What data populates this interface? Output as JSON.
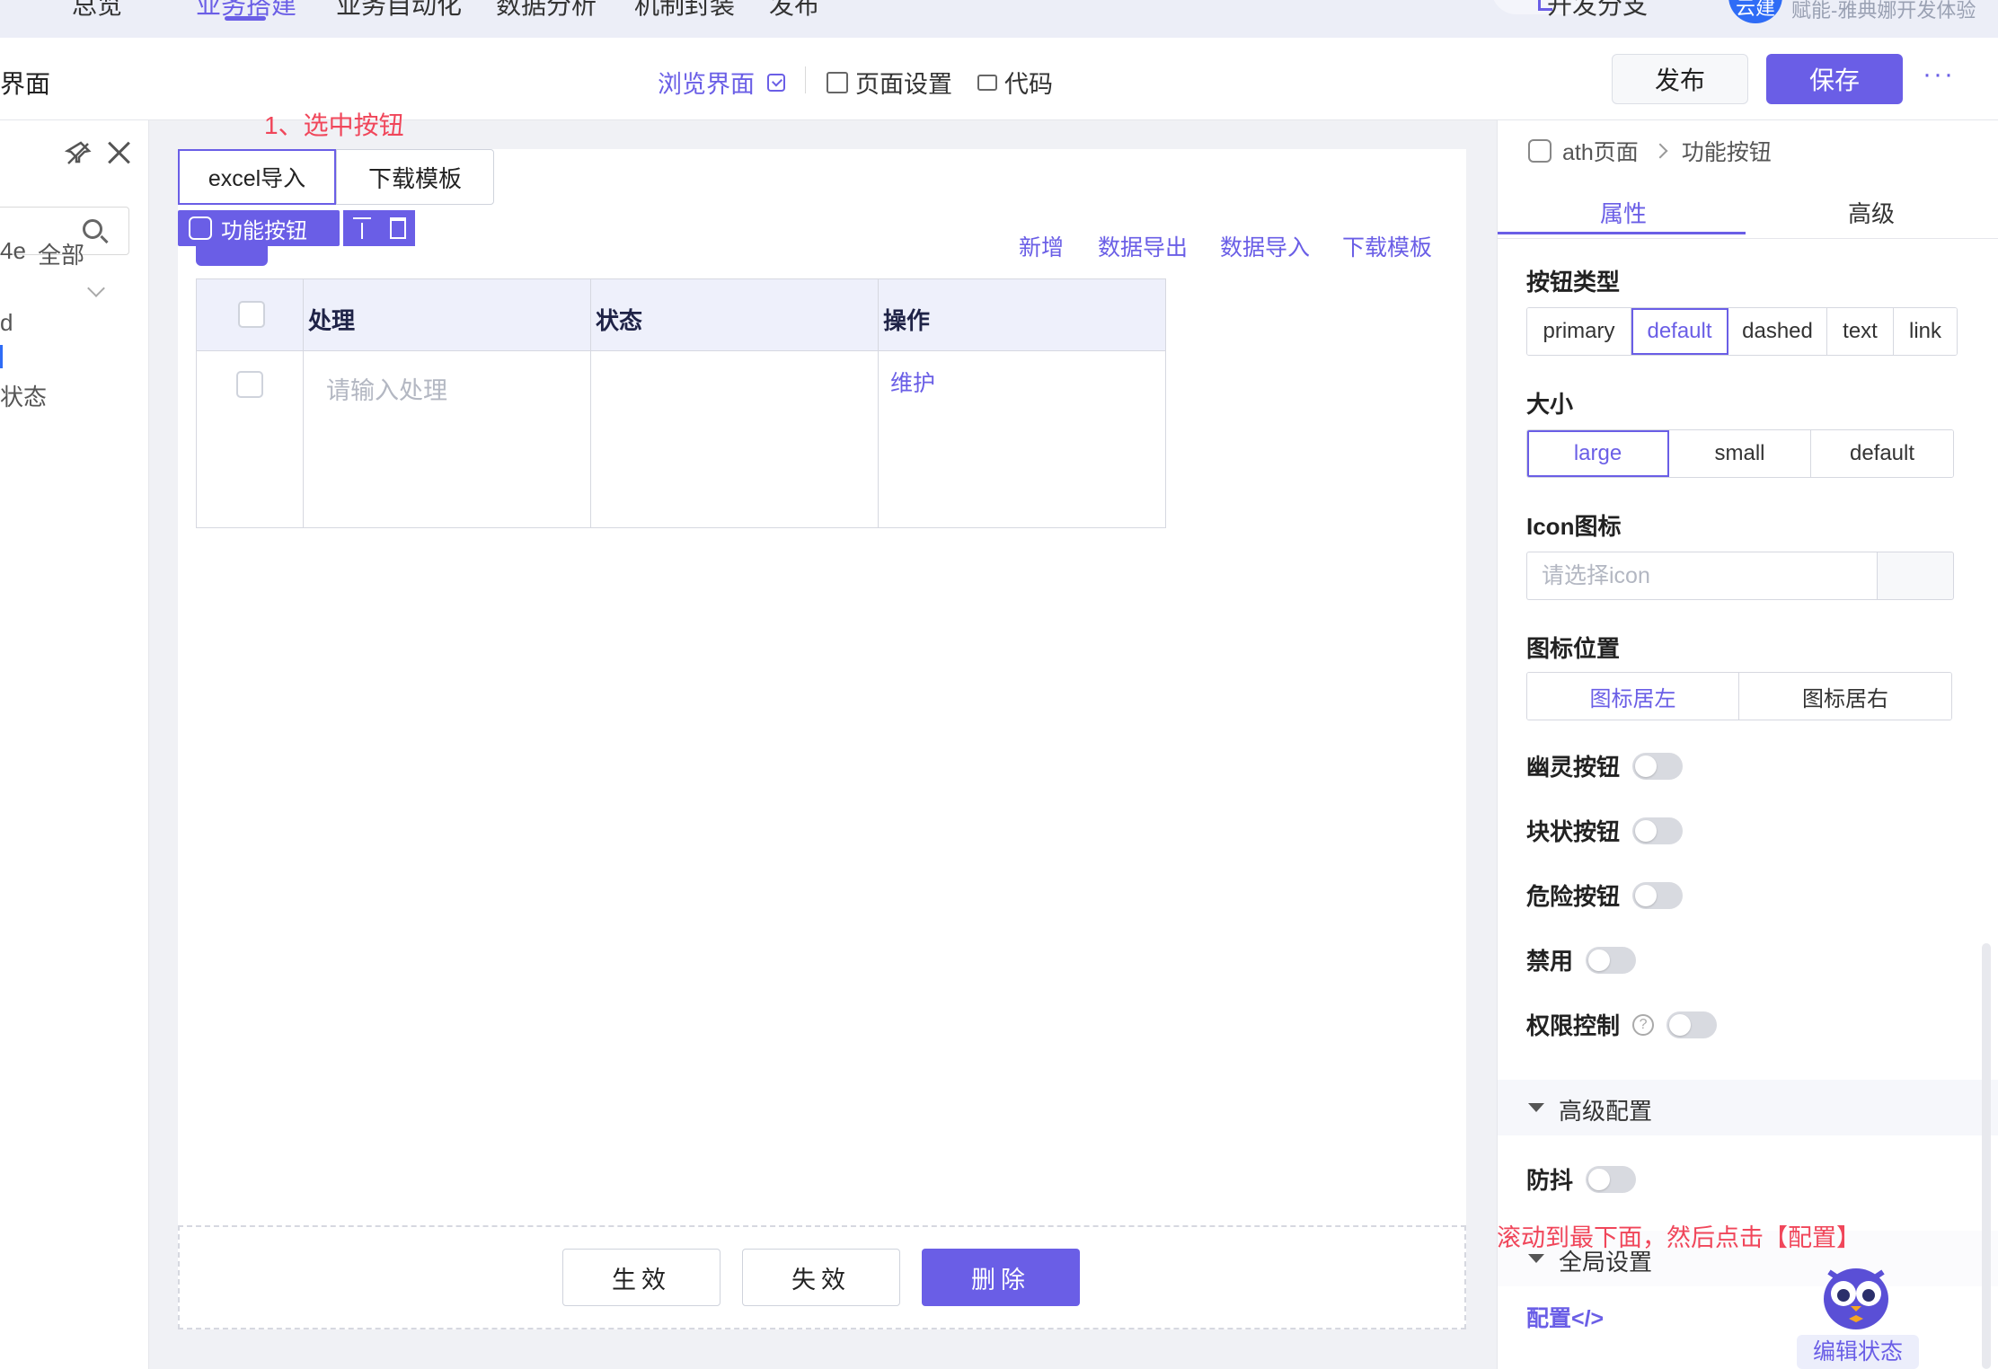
{
  "topnav": {
    "items": [
      "总览",
      "业务搭建",
      "业务自动化",
      "数据分析",
      "机制封装",
      "发布"
    ],
    "active_index": 1,
    "branch_label": "开发分支",
    "avatar_text": "云建",
    "user_label": "赋能-雅典娜开发体验"
  },
  "toolbar": {
    "page_name": "界面",
    "browse_label": "浏览界面",
    "page_settings_label": "页面设置",
    "code_label": "代码",
    "publish_label": "发布",
    "save_label": "保存",
    "more_label": "···"
  },
  "left_panel": {
    "row_all_prefix": "4e",
    "row_all_label": "全部",
    "row_d": "d",
    "row_status": "状态"
  },
  "canvas": {
    "hint_select": "1、选中按钮",
    "buttons": {
      "excel_import": "excel导入",
      "download_template": "下载模板"
    },
    "selection_tag": "功能按钮",
    "table_actions": [
      "新增",
      "数据导出",
      "数据导入",
      "下载模板"
    ],
    "table": {
      "headers": [
        "处理",
        "状态",
        "操作"
      ],
      "row_placeholder": "请输入处理",
      "row_action": "维护"
    },
    "footer_buttons": [
      "生效",
      "失效",
      "删除"
    ]
  },
  "right_panel": {
    "breadcrumb": [
      "ath页面",
      "功能按钮"
    ],
    "tabs": [
      "属性",
      "高级"
    ],
    "button_type": {
      "label": "按钮类型",
      "options": [
        "primary",
        "default",
        "dashed",
        "text",
        "link"
      ],
      "selected": "default"
    },
    "size": {
      "label": "大小",
      "options": [
        "large",
        "small",
        "default"
      ],
      "selected": "large"
    },
    "icon": {
      "label": "Icon图标",
      "placeholder": "请选择icon"
    },
    "icon_position": {
      "label": "图标位置",
      "options": [
        "图标居左",
        "图标居右"
      ],
      "selected": "图标居左"
    },
    "toggles": {
      "ghost": "幽灵按钮",
      "block": "块状按钮",
      "danger": "危险按钮",
      "disabled": "禁用",
      "permission": "权限控制"
    },
    "advanced_section": "高级配置",
    "debounce": "防抖",
    "hint_scroll": "滚动到最下面，然后点击【配置】",
    "global_section": "全局设置",
    "config_link": "配置</>",
    "edit_state": "编辑状态"
  },
  "colors": {
    "accent": "#6a5ee6",
    "hint": "#f0465a",
    "header_bg": "#eef0fb"
  }
}
